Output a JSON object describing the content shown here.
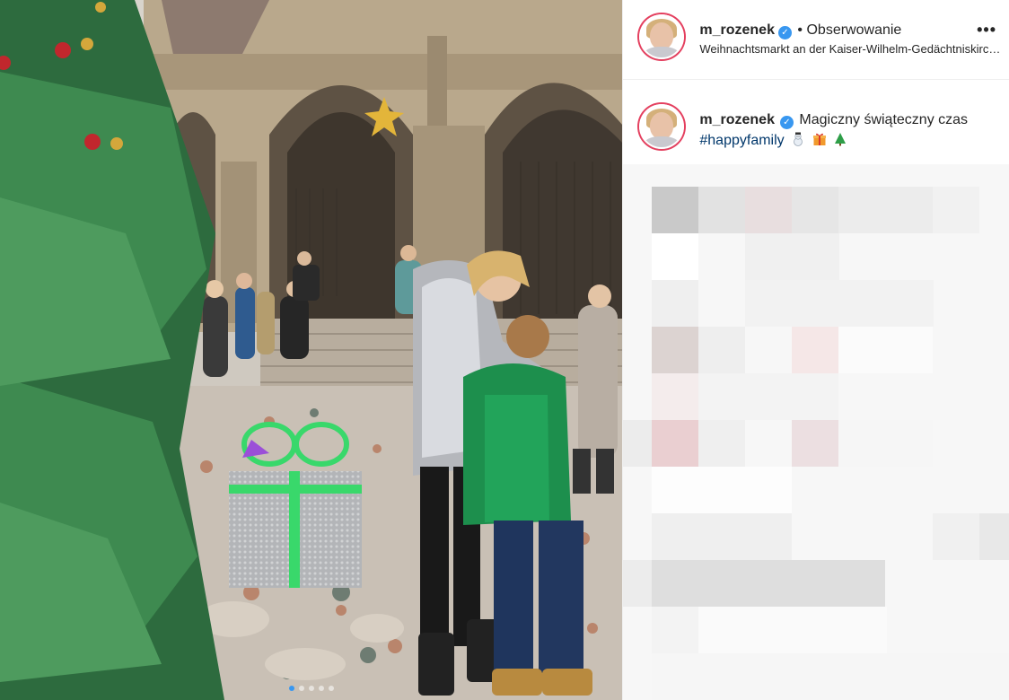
{
  "header": {
    "username": "m_rozenek",
    "verified_icon": "verified-badge-icon",
    "separator": "•",
    "follow_status": "Obserwowanie",
    "location": "Weihnachtsmarkt an der Kaiser-Wilhelm-Gedächtniskirche",
    "more_label": "•••"
  },
  "caption": {
    "username": "m_rozenek",
    "text": "Magiczny świąteczny czas",
    "hashtag": "#happyfamily",
    "emojis": [
      "snowman-icon",
      "gift-icon",
      "christmas-tree-icon"
    ]
  },
  "carousel": {
    "dot_count": 5,
    "active_index": 0
  },
  "colors": {
    "link": "#00376b",
    "verified": "#3897f0",
    "text": "#262626",
    "story_ring": "#e4405f"
  }
}
